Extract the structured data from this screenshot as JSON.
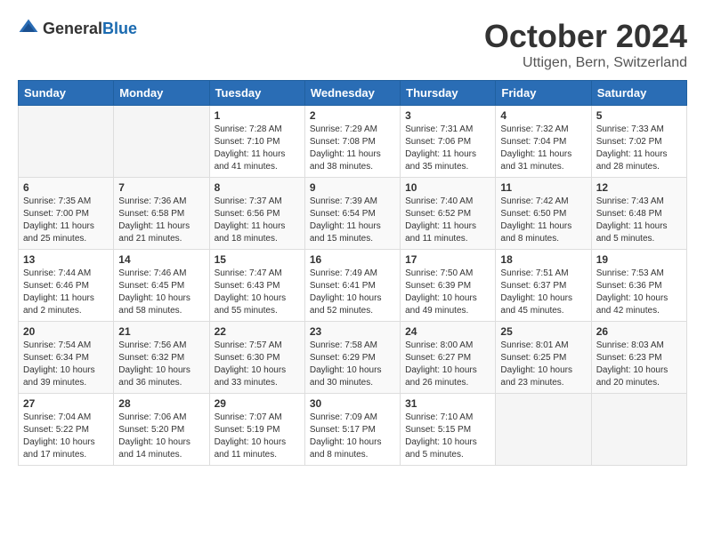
{
  "header": {
    "logo_general": "General",
    "logo_blue": "Blue",
    "month_year": "October 2024",
    "location": "Uttigen, Bern, Switzerland"
  },
  "days_of_week": [
    "Sunday",
    "Monday",
    "Tuesday",
    "Wednesday",
    "Thursday",
    "Friday",
    "Saturday"
  ],
  "weeks": [
    [
      {
        "day": "",
        "content": ""
      },
      {
        "day": "",
        "content": ""
      },
      {
        "day": "1",
        "content": "Sunrise: 7:28 AM\nSunset: 7:10 PM\nDaylight: 11 hours and 41 minutes."
      },
      {
        "day": "2",
        "content": "Sunrise: 7:29 AM\nSunset: 7:08 PM\nDaylight: 11 hours and 38 minutes."
      },
      {
        "day": "3",
        "content": "Sunrise: 7:31 AM\nSunset: 7:06 PM\nDaylight: 11 hours and 35 minutes."
      },
      {
        "day": "4",
        "content": "Sunrise: 7:32 AM\nSunset: 7:04 PM\nDaylight: 11 hours and 31 minutes."
      },
      {
        "day": "5",
        "content": "Sunrise: 7:33 AM\nSunset: 7:02 PM\nDaylight: 11 hours and 28 minutes."
      }
    ],
    [
      {
        "day": "6",
        "content": "Sunrise: 7:35 AM\nSunset: 7:00 PM\nDaylight: 11 hours and 25 minutes."
      },
      {
        "day": "7",
        "content": "Sunrise: 7:36 AM\nSunset: 6:58 PM\nDaylight: 11 hours and 21 minutes."
      },
      {
        "day": "8",
        "content": "Sunrise: 7:37 AM\nSunset: 6:56 PM\nDaylight: 11 hours and 18 minutes."
      },
      {
        "day": "9",
        "content": "Sunrise: 7:39 AM\nSunset: 6:54 PM\nDaylight: 11 hours and 15 minutes."
      },
      {
        "day": "10",
        "content": "Sunrise: 7:40 AM\nSunset: 6:52 PM\nDaylight: 11 hours and 11 minutes."
      },
      {
        "day": "11",
        "content": "Sunrise: 7:42 AM\nSunset: 6:50 PM\nDaylight: 11 hours and 8 minutes."
      },
      {
        "day": "12",
        "content": "Sunrise: 7:43 AM\nSunset: 6:48 PM\nDaylight: 11 hours and 5 minutes."
      }
    ],
    [
      {
        "day": "13",
        "content": "Sunrise: 7:44 AM\nSunset: 6:46 PM\nDaylight: 11 hours and 2 minutes."
      },
      {
        "day": "14",
        "content": "Sunrise: 7:46 AM\nSunset: 6:45 PM\nDaylight: 10 hours and 58 minutes."
      },
      {
        "day": "15",
        "content": "Sunrise: 7:47 AM\nSunset: 6:43 PM\nDaylight: 10 hours and 55 minutes."
      },
      {
        "day": "16",
        "content": "Sunrise: 7:49 AM\nSunset: 6:41 PM\nDaylight: 10 hours and 52 minutes."
      },
      {
        "day": "17",
        "content": "Sunrise: 7:50 AM\nSunset: 6:39 PM\nDaylight: 10 hours and 49 minutes."
      },
      {
        "day": "18",
        "content": "Sunrise: 7:51 AM\nSunset: 6:37 PM\nDaylight: 10 hours and 45 minutes."
      },
      {
        "day": "19",
        "content": "Sunrise: 7:53 AM\nSunset: 6:36 PM\nDaylight: 10 hours and 42 minutes."
      }
    ],
    [
      {
        "day": "20",
        "content": "Sunrise: 7:54 AM\nSunset: 6:34 PM\nDaylight: 10 hours and 39 minutes."
      },
      {
        "day": "21",
        "content": "Sunrise: 7:56 AM\nSunset: 6:32 PM\nDaylight: 10 hours and 36 minutes."
      },
      {
        "day": "22",
        "content": "Sunrise: 7:57 AM\nSunset: 6:30 PM\nDaylight: 10 hours and 33 minutes."
      },
      {
        "day": "23",
        "content": "Sunrise: 7:58 AM\nSunset: 6:29 PM\nDaylight: 10 hours and 30 minutes."
      },
      {
        "day": "24",
        "content": "Sunrise: 8:00 AM\nSunset: 6:27 PM\nDaylight: 10 hours and 26 minutes."
      },
      {
        "day": "25",
        "content": "Sunrise: 8:01 AM\nSunset: 6:25 PM\nDaylight: 10 hours and 23 minutes."
      },
      {
        "day": "26",
        "content": "Sunrise: 8:03 AM\nSunset: 6:23 PM\nDaylight: 10 hours and 20 minutes."
      }
    ],
    [
      {
        "day": "27",
        "content": "Sunrise: 7:04 AM\nSunset: 5:22 PM\nDaylight: 10 hours and 17 minutes."
      },
      {
        "day": "28",
        "content": "Sunrise: 7:06 AM\nSunset: 5:20 PM\nDaylight: 10 hours and 14 minutes."
      },
      {
        "day": "29",
        "content": "Sunrise: 7:07 AM\nSunset: 5:19 PM\nDaylight: 10 hours and 11 minutes."
      },
      {
        "day": "30",
        "content": "Sunrise: 7:09 AM\nSunset: 5:17 PM\nDaylight: 10 hours and 8 minutes."
      },
      {
        "day": "31",
        "content": "Sunrise: 7:10 AM\nSunset: 5:15 PM\nDaylight: 10 hours and 5 minutes."
      },
      {
        "day": "",
        "content": ""
      },
      {
        "day": "",
        "content": ""
      }
    ]
  ]
}
